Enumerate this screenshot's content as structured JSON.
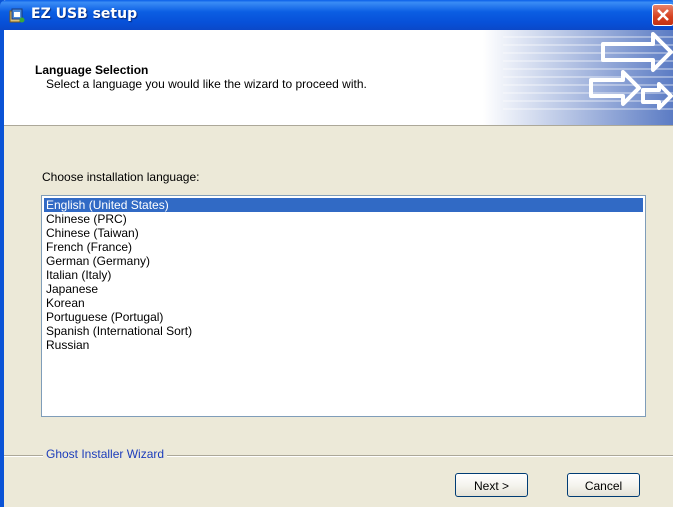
{
  "window": {
    "title": "EZ USB setup",
    "title_icon": "installer-icon",
    "close_icon": "close-icon"
  },
  "header": {
    "title": "Language Selection",
    "subtitle": "Select a language you would like the wizard to proceed with.",
    "art_icon": "arrows-graphic"
  },
  "body": {
    "choose_label": "Choose installation language:",
    "languages": [
      "English (United States)",
      "Chinese (PRC)",
      "Chinese (Taiwan)",
      "French (France)",
      "German (Germany)",
      "Italian (Italy)",
      "Japanese",
      "Korean",
      "Portuguese (Portugal)",
      "Spanish (International Sort)",
      "Russian"
    ],
    "selected_index": 0
  },
  "footer": {
    "group_label": "Ghost Installer Wizard",
    "next_label": "Next >",
    "cancel_label": "Cancel"
  },
  "colors": {
    "titlebar": "#0a5fe8",
    "selection": "#316ac5",
    "close": "#d5401f",
    "group_label": "#1c3dbb"
  }
}
